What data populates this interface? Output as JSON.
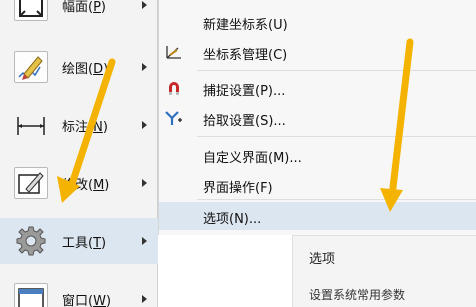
{
  "main_menu": {
    "items": [
      {
        "label": "幅面(",
        "key": "P",
        "suffix": ")"
      },
      {
        "label": "绘图(",
        "key": "D",
        "suffix": ")"
      },
      {
        "label": "标注(",
        "key": "N",
        "suffix": ")"
      },
      {
        "label": "修改(",
        "key": "M",
        "suffix": ")"
      },
      {
        "label": "工具(",
        "key": "T",
        "suffix": ")"
      },
      {
        "label": "窗口(",
        "key": "W",
        "suffix": ")"
      }
    ],
    "highlighted_index": 4
  },
  "submenu": {
    "items": [
      {
        "label": "新建坐标系(U)",
        "icon": "none"
      },
      {
        "label": "坐标系管理(C)",
        "icon": "coordinate-manager-icon"
      },
      {
        "label": "捕捉设置(P)...",
        "icon": "magnet-icon"
      },
      {
        "label": "拾取设置(S)...",
        "icon": "pick-settings-icon"
      },
      {
        "label": "自定义界面(M)...",
        "icon": "none"
      },
      {
        "label": "界面操作(F)",
        "icon": "none"
      },
      {
        "label": "选项(N)...",
        "icon": "none"
      }
    ],
    "highlighted_index": 6
  },
  "tooltip": {
    "title": "选项",
    "description": "设置系统常用参数"
  },
  "colors": {
    "highlight": "#dce6f1",
    "annotation_arrow": "#f5b301",
    "menu_bg": "#f3f3f3"
  }
}
